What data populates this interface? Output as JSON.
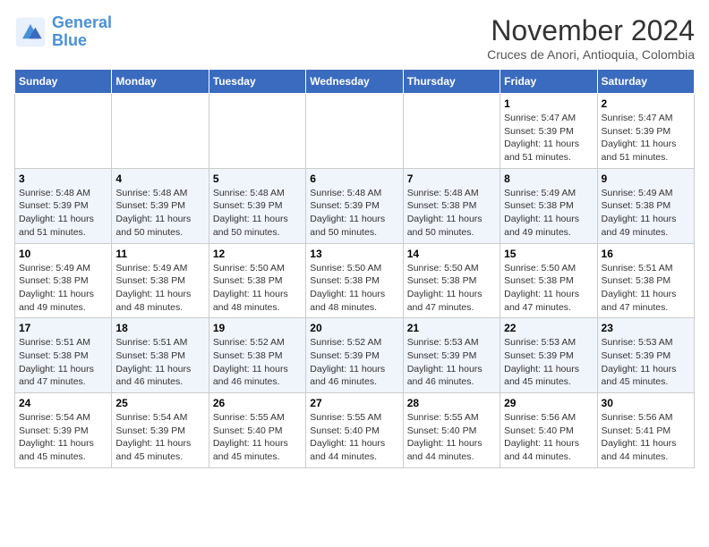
{
  "header": {
    "logo_line1": "General",
    "logo_line2": "Blue",
    "month": "November 2024",
    "location": "Cruces de Anori, Antioquia, Colombia"
  },
  "weekdays": [
    "Sunday",
    "Monday",
    "Tuesday",
    "Wednesday",
    "Thursday",
    "Friday",
    "Saturday"
  ],
  "weeks": [
    [
      {
        "day": "",
        "info": ""
      },
      {
        "day": "",
        "info": ""
      },
      {
        "day": "",
        "info": ""
      },
      {
        "day": "",
        "info": ""
      },
      {
        "day": "",
        "info": ""
      },
      {
        "day": "1",
        "info": "Sunrise: 5:47 AM\nSunset: 5:39 PM\nDaylight: 11 hours\nand 51 minutes."
      },
      {
        "day": "2",
        "info": "Sunrise: 5:47 AM\nSunset: 5:39 PM\nDaylight: 11 hours\nand 51 minutes."
      }
    ],
    [
      {
        "day": "3",
        "info": "Sunrise: 5:48 AM\nSunset: 5:39 PM\nDaylight: 11 hours\nand 51 minutes."
      },
      {
        "day": "4",
        "info": "Sunrise: 5:48 AM\nSunset: 5:39 PM\nDaylight: 11 hours\nand 50 minutes."
      },
      {
        "day": "5",
        "info": "Sunrise: 5:48 AM\nSunset: 5:39 PM\nDaylight: 11 hours\nand 50 minutes."
      },
      {
        "day": "6",
        "info": "Sunrise: 5:48 AM\nSunset: 5:39 PM\nDaylight: 11 hours\nand 50 minutes."
      },
      {
        "day": "7",
        "info": "Sunrise: 5:48 AM\nSunset: 5:38 PM\nDaylight: 11 hours\nand 50 minutes."
      },
      {
        "day": "8",
        "info": "Sunrise: 5:49 AM\nSunset: 5:38 PM\nDaylight: 11 hours\nand 49 minutes."
      },
      {
        "day": "9",
        "info": "Sunrise: 5:49 AM\nSunset: 5:38 PM\nDaylight: 11 hours\nand 49 minutes."
      }
    ],
    [
      {
        "day": "10",
        "info": "Sunrise: 5:49 AM\nSunset: 5:38 PM\nDaylight: 11 hours\nand 49 minutes."
      },
      {
        "day": "11",
        "info": "Sunrise: 5:49 AM\nSunset: 5:38 PM\nDaylight: 11 hours\nand 48 minutes."
      },
      {
        "day": "12",
        "info": "Sunrise: 5:50 AM\nSunset: 5:38 PM\nDaylight: 11 hours\nand 48 minutes."
      },
      {
        "day": "13",
        "info": "Sunrise: 5:50 AM\nSunset: 5:38 PM\nDaylight: 11 hours\nand 48 minutes."
      },
      {
        "day": "14",
        "info": "Sunrise: 5:50 AM\nSunset: 5:38 PM\nDaylight: 11 hours\nand 47 minutes."
      },
      {
        "day": "15",
        "info": "Sunrise: 5:50 AM\nSunset: 5:38 PM\nDaylight: 11 hours\nand 47 minutes."
      },
      {
        "day": "16",
        "info": "Sunrise: 5:51 AM\nSunset: 5:38 PM\nDaylight: 11 hours\nand 47 minutes."
      }
    ],
    [
      {
        "day": "17",
        "info": "Sunrise: 5:51 AM\nSunset: 5:38 PM\nDaylight: 11 hours\nand 47 minutes."
      },
      {
        "day": "18",
        "info": "Sunrise: 5:51 AM\nSunset: 5:38 PM\nDaylight: 11 hours\nand 46 minutes."
      },
      {
        "day": "19",
        "info": "Sunrise: 5:52 AM\nSunset: 5:38 PM\nDaylight: 11 hours\nand 46 minutes."
      },
      {
        "day": "20",
        "info": "Sunrise: 5:52 AM\nSunset: 5:39 PM\nDaylight: 11 hours\nand 46 minutes."
      },
      {
        "day": "21",
        "info": "Sunrise: 5:53 AM\nSunset: 5:39 PM\nDaylight: 11 hours\nand 46 minutes."
      },
      {
        "day": "22",
        "info": "Sunrise: 5:53 AM\nSunset: 5:39 PM\nDaylight: 11 hours\nand 45 minutes."
      },
      {
        "day": "23",
        "info": "Sunrise: 5:53 AM\nSunset: 5:39 PM\nDaylight: 11 hours\nand 45 minutes."
      }
    ],
    [
      {
        "day": "24",
        "info": "Sunrise: 5:54 AM\nSunset: 5:39 PM\nDaylight: 11 hours\nand 45 minutes."
      },
      {
        "day": "25",
        "info": "Sunrise: 5:54 AM\nSunset: 5:39 PM\nDaylight: 11 hours\nand 45 minutes."
      },
      {
        "day": "26",
        "info": "Sunrise: 5:55 AM\nSunset: 5:40 PM\nDaylight: 11 hours\nand 45 minutes."
      },
      {
        "day": "27",
        "info": "Sunrise: 5:55 AM\nSunset: 5:40 PM\nDaylight: 11 hours\nand 44 minutes."
      },
      {
        "day": "28",
        "info": "Sunrise: 5:55 AM\nSunset: 5:40 PM\nDaylight: 11 hours\nand 44 minutes."
      },
      {
        "day": "29",
        "info": "Sunrise: 5:56 AM\nSunset: 5:40 PM\nDaylight: 11 hours\nand 44 minutes."
      },
      {
        "day": "30",
        "info": "Sunrise: 5:56 AM\nSunset: 5:41 PM\nDaylight: 11 hours\nand 44 minutes."
      }
    ]
  ]
}
